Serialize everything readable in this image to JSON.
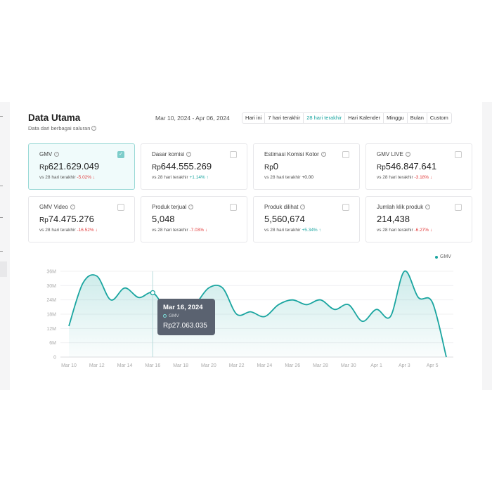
{
  "header": {
    "title": "Data Utama",
    "subtitle": "Data dari berbagai saluran",
    "date_range": "Mar 10, 2024 - Apr 06, 2024",
    "tabs": [
      {
        "label": "Hari ini",
        "active": false
      },
      {
        "label": "7 hari terakhir",
        "active": false
      },
      {
        "label": "28 hari terakhir",
        "active": true
      },
      {
        "label": "Hari Kalender",
        "active": false
      },
      {
        "label": "Minggu",
        "active": false
      },
      {
        "label": "Bulan",
        "active": false
      },
      {
        "label": "Custom",
        "active": false
      }
    ]
  },
  "cards": [
    {
      "label": "GMV",
      "currency": "Rp",
      "value": "621.629.049",
      "cmp": "vs 28 hari terakhir",
      "delta": "-5.02%",
      "arrow": "↓",
      "trend": "neg",
      "checked": true
    },
    {
      "label": "Dasar komisi",
      "currency": "Rp",
      "value": "644.555.269",
      "cmp": "vs 28 hari terakhir",
      "delta": "+1.14%",
      "arrow": "↑",
      "trend": "pos",
      "checked": false
    },
    {
      "label": "Estimasi Komisi Kotor",
      "currency": "Rp",
      "value": "0",
      "cmp": "vs 28 hari terakhir",
      "delta": "+0.00",
      "arrow": "",
      "trend": "neu",
      "checked": false
    },
    {
      "label": "GMV LIVE",
      "currency": "Rp",
      "value": "546.847.641",
      "cmp": "vs 28 hari terakhir",
      "delta": "-3.18%",
      "arrow": "↓",
      "trend": "neg",
      "checked": false
    },
    {
      "label": "GMV Video",
      "currency": "Rp",
      "value": "74.475.276",
      "cmp": "vs 28 hari terakhir",
      "delta": "-16.52%",
      "arrow": "↓",
      "trend": "neg",
      "checked": false
    },
    {
      "label": "Produk terjual",
      "currency": "",
      "value": "5,048",
      "cmp": "vs 28 hari terakhir",
      "delta": "-7.03%",
      "arrow": "↓",
      "trend": "neg",
      "checked": false
    },
    {
      "label": "Produk dilihat",
      "currency": "",
      "value": "5,560,674",
      "cmp": "vs 28 hari terakhir",
      "delta": "+5.34%",
      "arrow": "↑",
      "trend": "pos",
      "checked": false
    },
    {
      "label": "Jumlah klik produk",
      "currency": "",
      "value": "214,438",
      "cmp": "vs 28 hari terakhir",
      "delta": "-6.27%",
      "arrow": "↓",
      "trend": "neg",
      "checked": false
    }
  ],
  "tooltip": {
    "date": "Mar 16, 2024",
    "series": "GMV",
    "value": "Rp27.063.035"
  },
  "colors": {
    "accent": "#1aa5a0",
    "negative": "#e23b3b",
    "tooltip_bg": "#5a6270"
  },
  "chart_data": {
    "type": "area",
    "series": [
      {
        "name": "GMV",
        "values": [
          13,
          31,
          34,
          24,
          29,
          25,
          27,
          20,
          20,
          22,
          29,
          29,
          18,
          19,
          17,
          22,
          24,
          22,
          24,
          20,
          22,
          15,
          20,
          17,
          36,
          25,
          23,
          0
        ]
      }
    ],
    "x": [
      "Mar 10",
      "Mar 11",
      "Mar 12",
      "Mar 13",
      "Mar 14",
      "Mar 15",
      "Mar 16",
      "Mar 17",
      "Mar 18",
      "Mar 19",
      "Mar 20",
      "Mar 21",
      "Mar 22",
      "Mar 23",
      "Mar 24",
      "Mar 25",
      "Mar 26",
      "Mar 27",
      "Mar 28",
      "Mar 29",
      "Mar 30",
      "Mar 31",
      "Apr 1",
      "Apr 2",
      "Apr 3",
      "Apr 4",
      "Apr 5",
      "Apr 6"
    ],
    "x_tick_labels": [
      "Mar 10",
      "Mar 12",
      "Mar 14",
      "Mar 16",
      "Mar 18",
      "Mar 20",
      "Mar 22",
      "Mar 24",
      "Mar 26",
      "Mar 28",
      "Mar 30",
      "Apr 1",
      "Apr 3",
      "Apr 5"
    ],
    "y_tick_labels": [
      "0",
      "6M",
      "12M",
      "18M",
      "24M",
      "30M",
      "36M"
    ],
    "ylim": [
      0,
      36
    ],
    "y_unit": "M",
    "legend": "top-right",
    "grid": true,
    "highlight_index": 6
  }
}
